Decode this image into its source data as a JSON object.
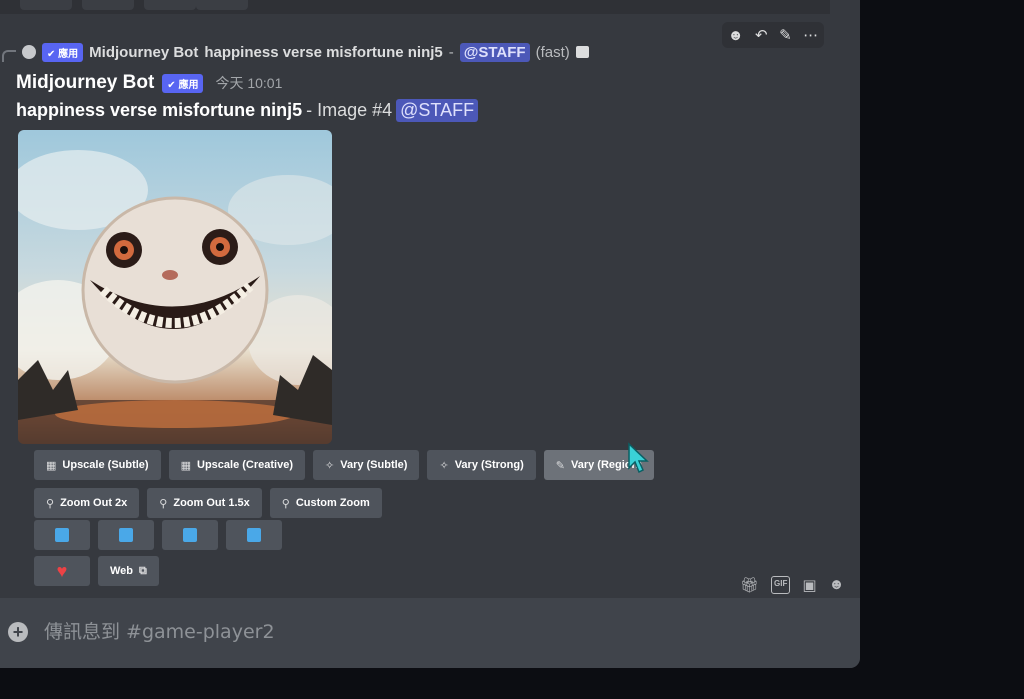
{
  "reply": {
    "badge": "✔ 應用",
    "author": "Midjourney Bot",
    "text": "happiness verse misfortune ninj5",
    "separator": "-",
    "mention": "@STAFF",
    "speed": "(fast)"
  },
  "toolbar": {
    "icons": [
      "emoji-icon",
      "reply-icon",
      "pin-icon",
      "more-icon"
    ]
  },
  "message": {
    "author": "Midjourney Bot",
    "badge": "✔ 應用",
    "timestamp": "今天 10:01",
    "prompt_bold": "happiness verse misfortune ninj5",
    "prompt_rest": "- Image #4",
    "mention": "@STAFF"
  },
  "buttons": {
    "upscale_subtle": "Upscale (Subtle)",
    "upscale_creative": "Upscale (Creative)",
    "vary_subtle": "Vary (Subtle)",
    "vary_strong": "Vary (Strong)",
    "vary_region": "Vary (Region)",
    "zoom_out_2x": "Zoom Out 2x",
    "zoom_out_1_5x": "Zoom Out 1.5x",
    "custom_zoom": "Custom Zoom",
    "web": "Web"
  },
  "composer": {
    "placeholder": "傳訊息到 #game-player2",
    "gif_label": "GIF"
  },
  "colors": {
    "background": "#36393f",
    "button": "#4f545c",
    "mention": "#4c58b8",
    "badge": "#5865f2"
  }
}
